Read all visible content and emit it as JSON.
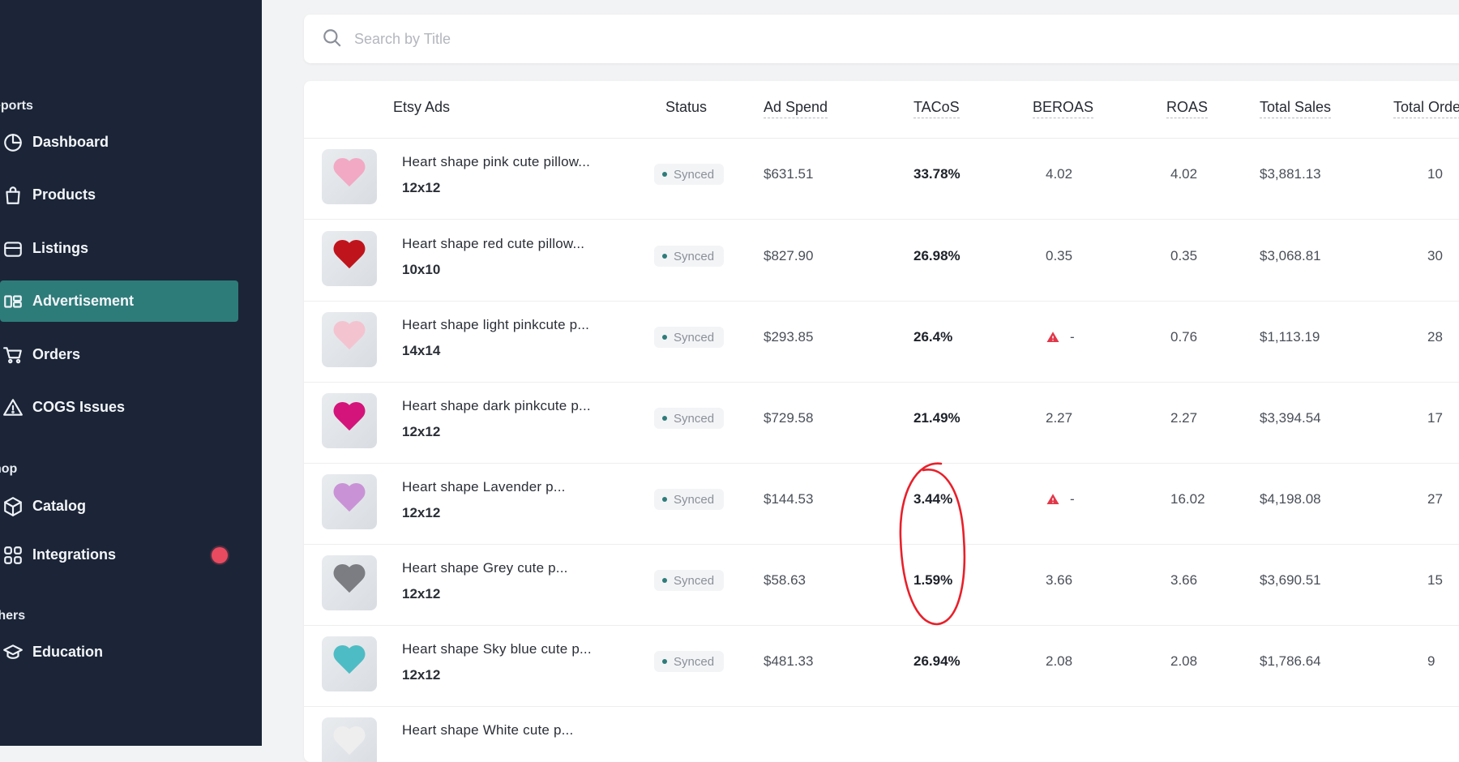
{
  "sidebar": {
    "sections": {
      "reports": "eports",
      "shop": "hop",
      "others": "thers"
    },
    "items": [
      {
        "label": "Dashboard",
        "icon": "pie-chart-icon"
      },
      {
        "label": "Products",
        "icon": "shopping-bag-icon"
      },
      {
        "label": "Listings",
        "icon": "inbox-icon"
      },
      {
        "label": "Advertisement",
        "icon": "layout-icon",
        "active": true
      },
      {
        "label": "Orders",
        "icon": "cart-icon"
      },
      {
        "label": "COGS Issues",
        "icon": "warning-icon"
      },
      {
        "label": "Catalog",
        "icon": "box-icon"
      },
      {
        "label": "Integrations",
        "icon": "grid-icon"
      },
      {
        "label": "Education",
        "icon": "graduation-cap-icon"
      }
    ],
    "accent_color": "#2e7c7a",
    "background_color": "#1b2537",
    "notification_color": "#e84a5f"
  },
  "search": {
    "placeholder": "Search by Title"
  },
  "table": {
    "headers": {
      "product": "Etsy Ads",
      "status": "Status",
      "ad_spend": "Ad Spend",
      "tacos": "TACoS",
      "beroas": "BEROAS",
      "roas": "ROAS",
      "total_sales": "Total Sales",
      "total_orders": "Total Orde"
    },
    "rows": [
      {
        "title": "Heart shape pink cute pillow...",
        "size": "12x12",
        "status": "Synced",
        "ad_spend": "$631.51",
        "tacos": "33.78%",
        "beroas": "4.02",
        "roas": "4.02",
        "total_sales": "$3,881.13",
        "total_orders": "10",
        "swatch": "#f2a9c4"
      },
      {
        "title": "Heart shape red cute pillow...",
        "size": "10x10",
        "status": "Synced",
        "ad_spend": "$827.90",
        "tacos": "26.98%",
        "beroas": "0.35",
        "roas": "0.35",
        "total_sales": "$3,068.81",
        "total_orders": "30",
        "swatch": "#c0141c"
      },
      {
        "title": "Heart shape light pinkcute p...",
        "size": "14x14",
        "status": "Synced",
        "ad_spend": "$293.85",
        "tacos": "26.4%",
        "beroas": "-",
        "beroas_warning": true,
        "roas": "0.76",
        "total_sales": "$1,113.19",
        "total_orders": "28",
        "swatch": "#f4c3d0"
      },
      {
        "title": "Heart shape dark pinkcute p...",
        "size": "12x12",
        "status": "Synced",
        "ad_spend": "$729.58",
        "tacos": "21.49%",
        "beroas": "2.27",
        "roas": "2.27",
        "total_sales": "$3,394.54",
        "total_orders": "17",
        "swatch": "#d4147a"
      },
      {
        "title": "Heart shape Lavender p...",
        "size": "12x12",
        "status": "Synced",
        "ad_spend": "$144.53",
        "tacos": "3.44%",
        "beroas": "-",
        "beroas_warning": true,
        "roas": "16.02",
        "total_sales": "$4,198.08",
        "total_orders": "27",
        "swatch": "#c992d6"
      },
      {
        "title": "Heart shape Grey cute p...",
        "size": "12x12",
        "status": "Synced",
        "ad_spend": "$58.63",
        "tacos": "1.59%",
        "beroas": "3.66",
        "roas": "3.66",
        "total_sales": "$3,690.51",
        "total_orders": "15",
        "swatch": "#7b7d82"
      },
      {
        "title": "Heart shape Sky blue cute p...",
        "size": "12x12",
        "status": "Synced",
        "ad_spend": "$481.33",
        "tacos": "26.94%",
        "beroas": "2.08",
        "roas": "2.08",
        "total_sales": "$1,786.64",
        "total_orders": "9",
        "swatch": "#4ebcc4"
      },
      {
        "title": "Heart shape White cute p...",
        "size": "",
        "status": "",
        "ad_spend": "",
        "tacos": "",
        "beroas": "",
        "roas": "",
        "total_sales": "",
        "total_orders": "",
        "swatch": "#eeeeee"
      }
    ]
  },
  "annotation_color": "#e8202a"
}
